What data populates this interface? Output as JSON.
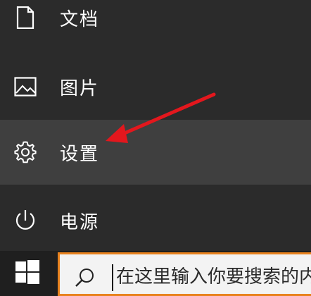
{
  "menu": {
    "items": [
      {
        "label": "文档",
        "icon": "document-icon"
      },
      {
        "label": "图片",
        "icon": "pictures-icon"
      },
      {
        "label": "设置",
        "icon": "gear-icon"
      },
      {
        "label": "电源",
        "icon": "power-icon"
      }
    ],
    "highlighted": "设置"
  },
  "taskbar": {
    "search": {
      "placeholder": "在这里输入你要搜索的内容",
      "icon": "search-icon"
    },
    "start_icon": "windows-logo-icon"
  },
  "colors": {
    "menu_bg": "#2b2b2b",
    "highlight_bg": "#3f3f3f",
    "arrow": "#e3171d",
    "search_border": "#e8821e"
  }
}
